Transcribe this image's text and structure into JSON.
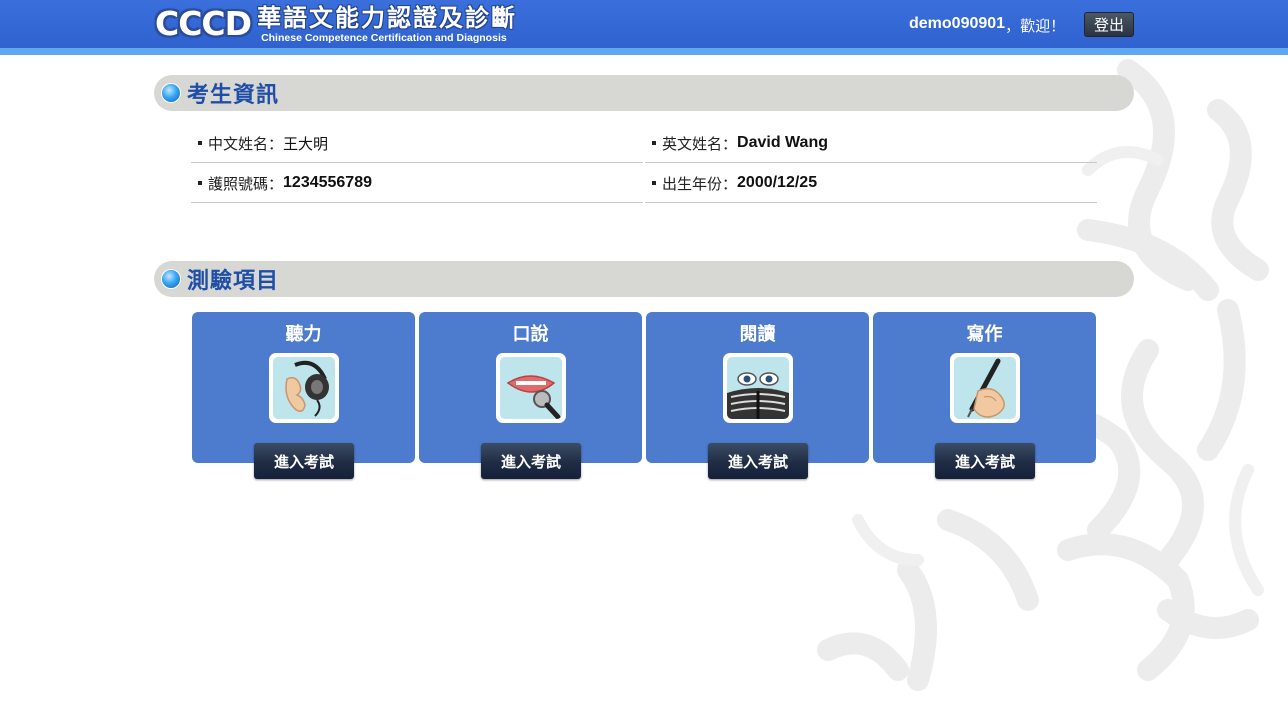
{
  "header": {
    "logo_mark": "CCCD",
    "logo_title": "華語文能力認證及診斷",
    "logo_subtitle": "Chinese Competence Certification and Diagnosis",
    "username": "demo090901",
    "welcome_suffix": "，歡迎！",
    "logout_label": "登出"
  },
  "candidate": {
    "section_title": "考生資訊",
    "fields": [
      {
        "label": "中文姓名：",
        "value": "王大明"
      },
      {
        "label": "英文姓名：",
        "value": "David Wang"
      },
      {
        "label": "護照號碼：",
        "value": "1234556789"
      },
      {
        "label": "出生年份：",
        "value": "2000/12/25"
      }
    ]
  },
  "tests": {
    "section_title": "測驗項目",
    "items": [
      {
        "title": "聽力",
        "icon": "headphones-ear-icon",
        "button": "進入考試"
      },
      {
        "title": "口說",
        "icon": "mouth-microphone-icon",
        "button": "進入考試"
      },
      {
        "title": "閱讀",
        "icon": "eyes-book-icon",
        "button": "進入考試"
      },
      {
        "title": "寫作",
        "icon": "hand-pen-icon",
        "button": "進入考試"
      }
    ]
  },
  "colors": {
    "header_blue": "#3a6fdc",
    "header_strip": "#5fa8f0",
    "section_bar": "#d7d8d4",
    "section_title": "#1f4ea8",
    "card_blue": "#4d7bcd",
    "button_dark": "#1f2c44"
  }
}
